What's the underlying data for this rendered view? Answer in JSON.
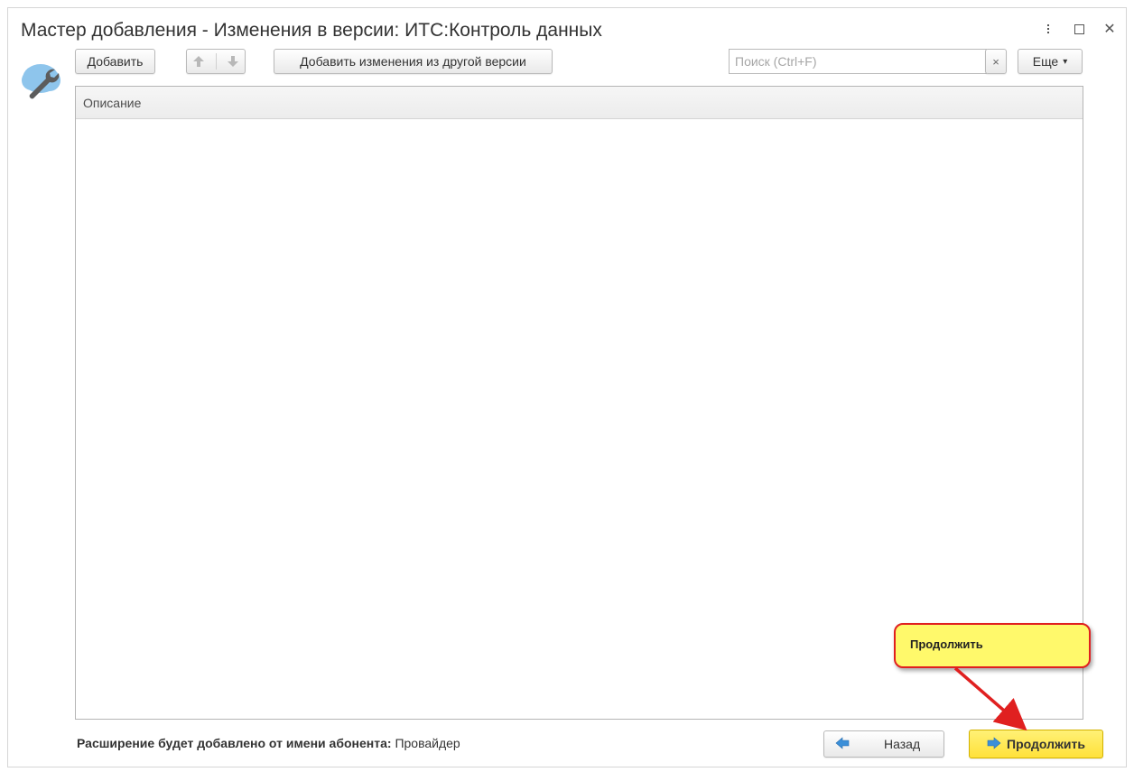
{
  "window": {
    "title": "Мастер добавления - Изменения в версии: ИТС:Контроль данных"
  },
  "toolbar": {
    "add_label": "Добавить",
    "add_from_other_label": "Добавить изменения из другой версии",
    "search_placeholder": "Поиск (Ctrl+F)",
    "search_value": "",
    "clear_symbol": "×",
    "more_label": "Еще"
  },
  "table": {
    "columns": [
      "Описание"
    ],
    "rows": []
  },
  "footer": {
    "info_label": "Расширение будет добавлено от имени абонента:",
    "info_value": "Провайдер",
    "back_label": "Назад",
    "continue_label": "Продолжить"
  },
  "callout": {
    "text": "Продолжить"
  },
  "icons": {
    "app_logo": "cloud-wrench-icon",
    "up": "arrow-up-icon",
    "down": "arrow-down-icon",
    "back": "arrow-left-icon",
    "continue": "arrow-right-icon"
  },
  "colors": {
    "accent_yellow": "#ffe13a",
    "callout_fill": "#fff96b",
    "callout_border": "#e02020",
    "arrow_blue": "#3b8fd8"
  }
}
